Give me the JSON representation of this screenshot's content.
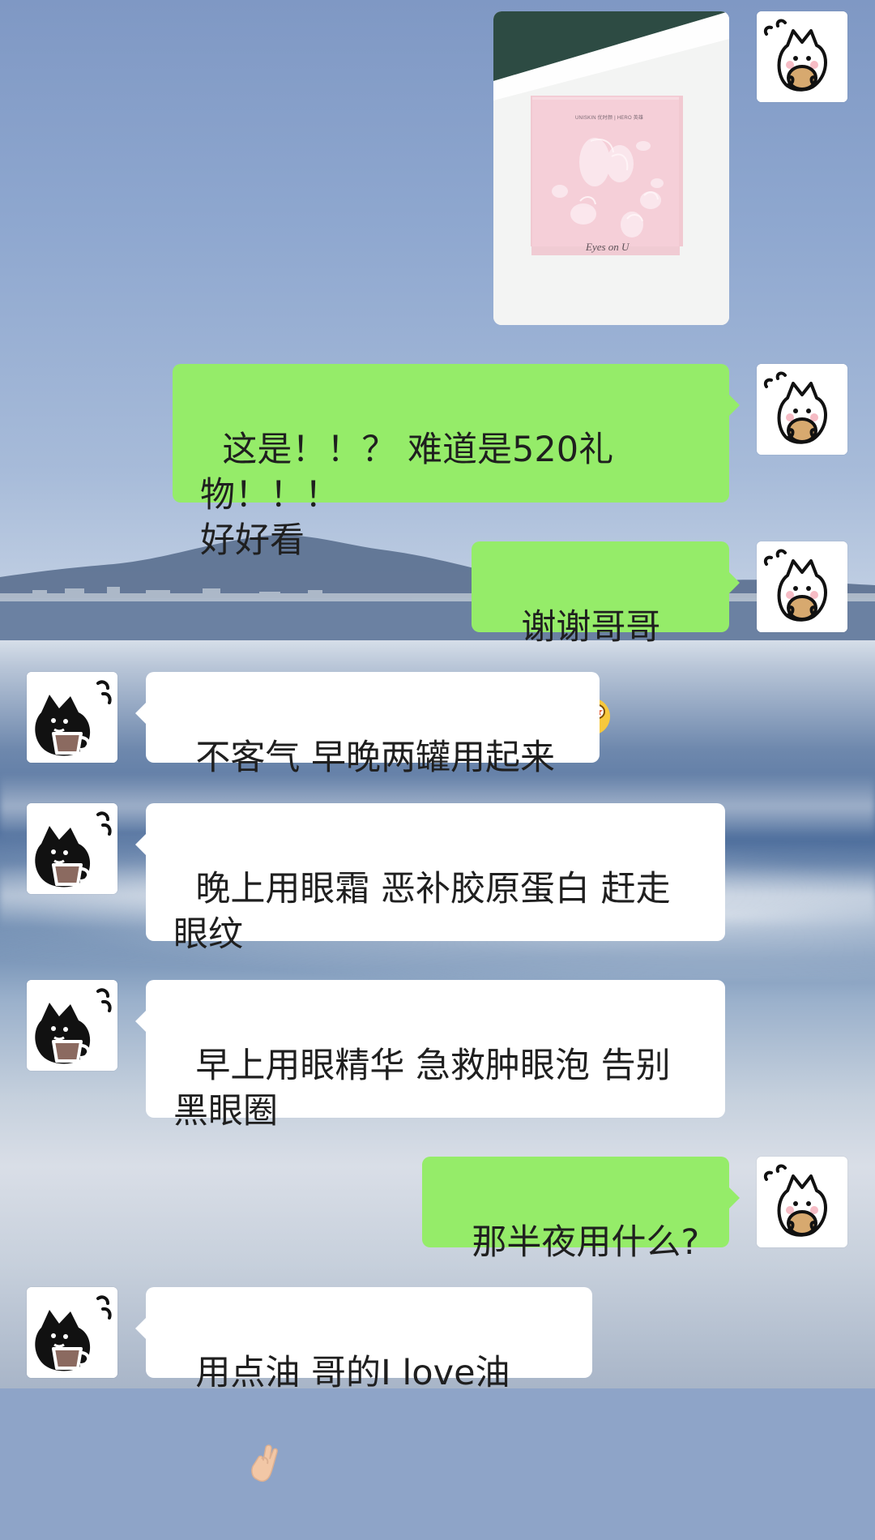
{
  "messages": {
    "m1": {
      "type": "image",
      "image": {
        "brand_line": "UNISKIN 优时颜 | HERO 英雄",
        "product_text": "Eyes on U"
      }
    },
    "m2": {
      "text": "这是！！？ 难道是520礼物！！！\n好好看"
    },
    "m3": {
      "text": "谢谢哥哥"
    },
    "m4": {
      "text": "不客气 早晚两罐用起来"
    },
    "m5": {
      "text": "晚上用眼霜 恶补胶原蛋白 赶走\n眼纹"
    },
    "m6": {
      "text": "早上用眼精华 急救肿眼泡 告别\n黑眼圈"
    },
    "m7": {
      "text": "那半夜用什么?"
    },
    "m8": {
      "text": "用点油 哥的I love油"
    }
  },
  "colors": {
    "outgoing_bubble": "#95ec69",
    "incoming_bubble": "#ffffff",
    "text": "#1f1f1f"
  },
  "icons": {
    "outgoing_avatar": "white-cat-avatar-icon",
    "incoming_avatar": "black-cat-avatar-icon",
    "emoji_m3": "star-eyes-face-emoji",
    "emoji_m8": "crossed-fingers-emoji"
  }
}
